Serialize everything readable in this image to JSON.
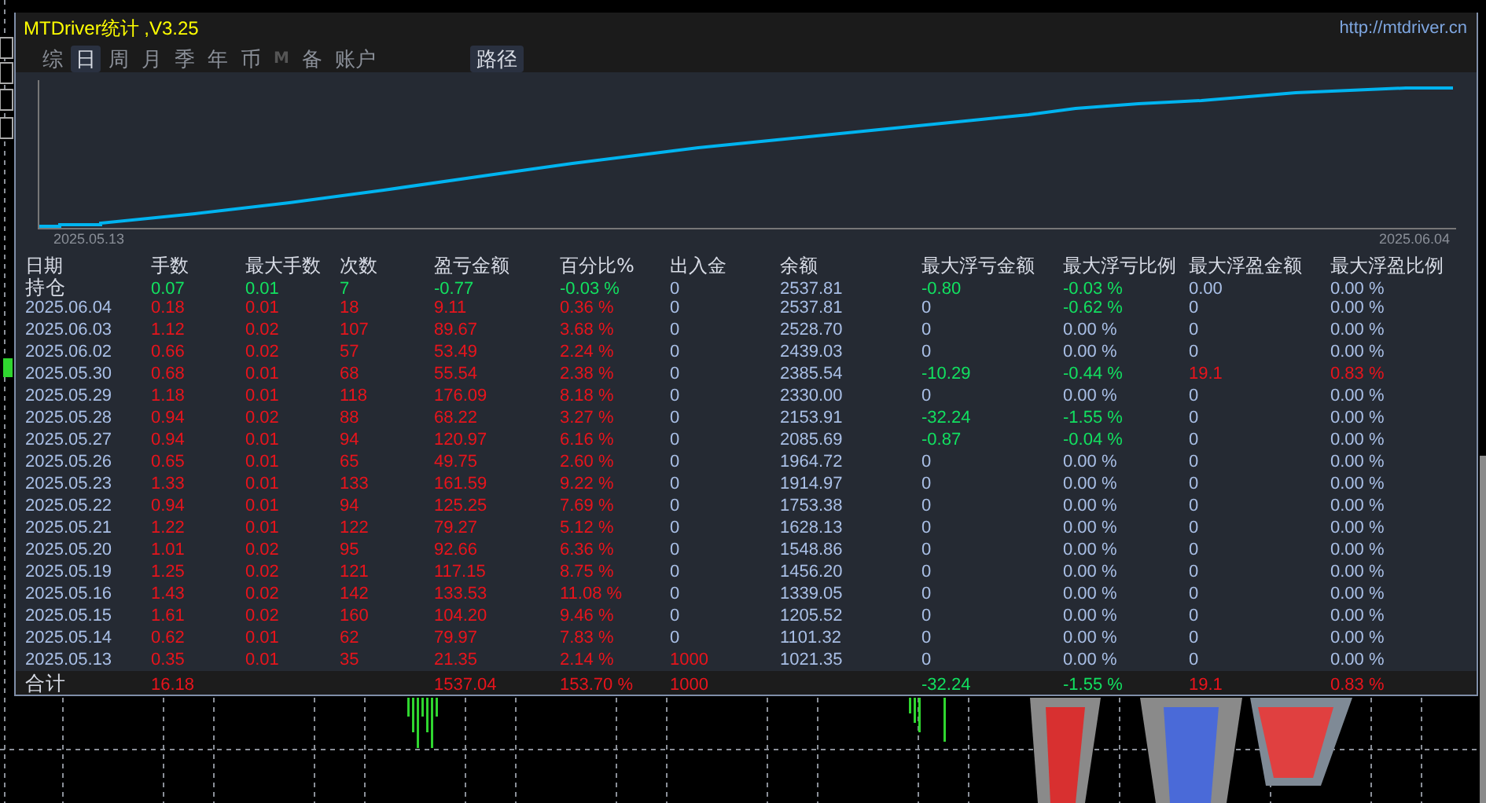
{
  "window": {
    "title": "MTDriver统计 ,V3.25",
    "link": "http://mtdriver.cn"
  },
  "tabs": [
    {
      "label": "综",
      "selected": false,
      "disabled": false
    },
    {
      "label": "日",
      "selected": true,
      "disabled": false
    },
    {
      "label": "周",
      "selected": false,
      "disabled": false
    },
    {
      "label": "月",
      "selected": false,
      "disabled": false
    },
    {
      "label": "季",
      "selected": false,
      "disabled": false
    },
    {
      "label": "年",
      "selected": false,
      "disabled": false
    },
    {
      "label": "币",
      "selected": false,
      "disabled": false
    },
    {
      "label": "M",
      "selected": false,
      "disabled": true
    },
    {
      "label": "备",
      "selected": false,
      "disabled": false
    },
    {
      "label": "账户",
      "selected": false,
      "disabled": false
    }
  ],
  "path_button": "路径",
  "balance_chart": {
    "start_date": "2025.05.13",
    "end_date": "2025.06.04"
  },
  "table": {
    "columns": [
      "日期",
      "手数",
      "最大手数",
      "次数",
      "盈亏金额",
      "百分比%",
      "出入金",
      "余额",
      "最大浮亏金额",
      "最大浮亏比例",
      "最大浮盈金额",
      "最大浮盈比例"
    ],
    "rows": [
      {
        "kind": "position",
        "cells": [
          {
            "text": "持仓",
            "color": "#d8dce6"
          },
          {
            "text": "0.07",
            "color": "#12e060"
          },
          {
            "text": "0.01",
            "color": "#12e060"
          },
          {
            "text": "7",
            "color": "#12e060"
          },
          {
            "text": "-0.77",
            "color": "#12e060"
          },
          {
            "text": "-0.03 %",
            "color": "#12e060"
          },
          {
            "text": "0",
            "color": "#a9bfe6"
          },
          {
            "text": "2537.81",
            "color": "#a9bfe6"
          },
          {
            "text": "-0.80",
            "color": "#12e060"
          },
          {
            "text": "-0.03 %",
            "color": "#12e060"
          },
          {
            "text": "0.00",
            "color": "#a9bfe6"
          },
          {
            "text": "0.00 %",
            "color": "#a9bfe6"
          }
        ]
      },
      {
        "kind": "day",
        "cells": [
          {
            "text": "2025.06.04",
            "color": "#a9bfe6"
          },
          {
            "text": "0.18",
            "color": "#e8141c"
          },
          {
            "text": "0.01",
            "color": "#e8141c"
          },
          {
            "text": "18",
            "color": "#e8141c"
          },
          {
            "text": "9.11",
            "color": "#e8141c"
          },
          {
            "text": "0.36 %",
            "color": "#e8141c"
          },
          {
            "text": "0",
            "color": "#a9bfe6"
          },
          {
            "text": "2537.81",
            "color": "#a9bfe6"
          },
          {
            "text": "0",
            "color": "#a9bfe6"
          },
          {
            "text": "-0.62 %",
            "color": "#12e060"
          },
          {
            "text": "0",
            "color": "#a9bfe6"
          },
          {
            "text": "0.00 %",
            "color": "#a9bfe6"
          }
        ]
      },
      {
        "kind": "day",
        "cells": [
          {
            "text": "2025.06.03",
            "color": "#a9bfe6"
          },
          {
            "text": "1.12",
            "color": "#e8141c"
          },
          {
            "text": "0.02",
            "color": "#e8141c"
          },
          {
            "text": "107",
            "color": "#e8141c"
          },
          {
            "text": "89.67",
            "color": "#e8141c"
          },
          {
            "text": "3.68 %",
            "color": "#e8141c"
          },
          {
            "text": "0",
            "color": "#a9bfe6"
          },
          {
            "text": "2528.70",
            "color": "#a9bfe6"
          },
          {
            "text": "0",
            "color": "#a9bfe6"
          },
          {
            "text": "0.00 %",
            "color": "#a9bfe6"
          },
          {
            "text": "0",
            "color": "#a9bfe6"
          },
          {
            "text": "0.00 %",
            "color": "#a9bfe6"
          }
        ]
      },
      {
        "kind": "day",
        "cells": [
          {
            "text": "2025.06.02",
            "color": "#a9bfe6"
          },
          {
            "text": "0.66",
            "color": "#e8141c"
          },
          {
            "text": "0.02",
            "color": "#e8141c"
          },
          {
            "text": "57",
            "color": "#e8141c"
          },
          {
            "text": "53.49",
            "color": "#e8141c"
          },
          {
            "text": "2.24 %",
            "color": "#e8141c"
          },
          {
            "text": "0",
            "color": "#a9bfe6"
          },
          {
            "text": "2439.03",
            "color": "#a9bfe6"
          },
          {
            "text": "0",
            "color": "#a9bfe6"
          },
          {
            "text": "0.00 %",
            "color": "#a9bfe6"
          },
          {
            "text": "0",
            "color": "#a9bfe6"
          },
          {
            "text": "0.00 %",
            "color": "#a9bfe6"
          }
        ]
      },
      {
        "kind": "day",
        "cells": [
          {
            "text": "2025.05.30",
            "color": "#a9bfe6"
          },
          {
            "text": "0.68",
            "color": "#e8141c"
          },
          {
            "text": "0.01",
            "color": "#e8141c"
          },
          {
            "text": "68",
            "color": "#e8141c"
          },
          {
            "text": "55.54",
            "color": "#e8141c"
          },
          {
            "text": "2.38 %",
            "color": "#e8141c"
          },
          {
            "text": "0",
            "color": "#a9bfe6"
          },
          {
            "text": "2385.54",
            "color": "#a9bfe6"
          },
          {
            "text": "-10.29",
            "color": "#12e060"
          },
          {
            "text": "-0.44 %",
            "color": "#12e060"
          },
          {
            "text": "19.1",
            "color": "#e8141c"
          },
          {
            "text": "0.83 %",
            "color": "#e8141c"
          }
        ]
      },
      {
        "kind": "day",
        "cells": [
          {
            "text": "2025.05.29",
            "color": "#a9bfe6"
          },
          {
            "text": "1.18",
            "color": "#e8141c"
          },
          {
            "text": "0.01",
            "color": "#e8141c"
          },
          {
            "text": "118",
            "color": "#e8141c"
          },
          {
            "text": "176.09",
            "color": "#e8141c"
          },
          {
            "text": "8.18 %",
            "color": "#e8141c"
          },
          {
            "text": "0",
            "color": "#a9bfe6"
          },
          {
            "text": "2330.00",
            "color": "#a9bfe6"
          },
          {
            "text": "0",
            "color": "#a9bfe6"
          },
          {
            "text": "0.00 %",
            "color": "#a9bfe6"
          },
          {
            "text": "0",
            "color": "#a9bfe6"
          },
          {
            "text": "0.00 %",
            "color": "#a9bfe6"
          }
        ]
      },
      {
        "kind": "day",
        "cells": [
          {
            "text": "2025.05.28",
            "color": "#a9bfe6"
          },
          {
            "text": "0.94",
            "color": "#e8141c"
          },
          {
            "text": "0.02",
            "color": "#e8141c"
          },
          {
            "text": "88",
            "color": "#e8141c"
          },
          {
            "text": "68.22",
            "color": "#e8141c"
          },
          {
            "text": "3.27 %",
            "color": "#e8141c"
          },
          {
            "text": "0",
            "color": "#a9bfe6"
          },
          {
            "text": "2153.91",
            "color": "#a9bfe6"
          },
          {
            "text": "-32.24",
            "color": "#12e060"
          },
          {
            "text": "-1.55 %",
            "color": "#12e060"
          },
          {
            "text": "0",
            "color": "#a9bfe6"
          },
          {
            "text": "0.00 %",
            "color": "#a9bfe6"
          }
        ]
      },
      {
        "kind": "day",
        "cells": [
          {
            "text": "2025.05.27",
            "color": "#a9bfe6"
          },
          {
            "text": "0.94",
            "color": "#e8141c"
          },
          {
            "text": "0.01",
            "color": "#e8141c"
          },
          {
            "text": "94",
            "color": "#e8141c"
          },
          {
            "text": "120.97",
            "color": "#e8141c"
          },
          {
            "text": "6.16 %",
            "color": "#e8141c"
          },
          {
            "text": "0",
            "color": "#a9bfe6"
          },
          {
            "text": "2085.69",
            "color": "#a9bfe6"
          },
          {
            "text": "-0.87",
            "color": "#12e060"
          },
          {
            "text": "-0.04 %",
            "color": "#12e060"
          },
          {
            "text": "0",
            "color": "#a9bfe6"
          },
          {
            "text": "0.00 %",
            "color": "#a9bfe6"
          }
        ]
      },
      {
        "kind": "day",
        "cells": [
          {
            "text": "2025.05.26",
            "color": "#a9bfe6"
          },
          {
            "text": "0.65",
            "color": "#e8141c"
          },
          {
            "text": "0.01",
            "color": "#e8141c"
          },
          {
            "text": "65",
            "color": "#e8141c"
          },
          {
            "text": "49.75",
            "color": "#e8141c"
          },
          {
            "text": "2.60 %",
            "color": "#e8141c"
          },
          {
            "text": "0",
            "color": "#a9bfe6"
          },
          {
            "text": "1964.72",
            "color": "#a9bfe6"
          },
          {
            "text": "0",
            "color": "#a9bfe6"
          },
          {
            "text": "0.00 %",
            "color": "#a9bfe6"
          },
          {
            "text": "0",
            "color": "#a9bfe6"
          },
          {
            "text": "0.00 %",
            "color": "#a9bfe6"
          }
        ]
      },
      {
        "kind": "day",
        "cells": [
          {
            "text": "2025.05.23",
            "color": "#a9bfe6"
          },
          {
            "text": "1.33",
            "color": "#e8141c"
          },
          {
            "text": "0.01",
            "color": "#e8141c"
          },
          {
            "text": "133",
            "color": "#e8141c"
          },
          {
            "text": "161.59",
            "color": "#e8141c"
          },
          {
            "text": "9.22 %",
            "color": "#e8141c"
          },
          {
            "text": "0",
            "color": "#a9bfe6"
          },
          {
            "text": "1914.97",
            "color": "#a9bfe6"
          },
          {
            "text": "0",
            "color": "#a9bfe6"
          },
          {
            "text": "0.00 %",
            "color": "#a9bfe6"
          },
          {
            "text": "0",
            "color": "#a9bfe6"
          },
          {
            "text": "0.00 %",
            "color": "#a9bfe6"
          }
        ]
      },
      {
        "kind": "day",
        "cells": [
          {
            "text": "2025.05.22",
            "color": "#a9bfe6"
          },
          {
            "text": "0.94",
            "color": "#e8141c"
          },
          {
            "text": "0.01",
            "color": "#e8141c"
          },
          {
            "text": "94",
            "color": "#e8141c"
          },
          {
            "text": "125.25",
            "color": "#e8141c"
          },
          {
            "text": "7.69 %",
            "color": "#e8141c"
          },
          {
            "text": "0",
            "color": "#a9bfe6"
          },
          {
            "text": "1753.38",
            "color": "#a9bfe6"
          },
          {
            "text": "0",
            "color": "#a9bfe6"
          },
          {
            "text": "0.00 %",
            "color": "#a9bfe6"
          },
          {
            "text": "0",
            "color": "#a9bfe6"
          },
          {
            "text": "0.00 %",
            "color": "#a9bfe6"
          }
        ]
      },
      {
        "kind": "day",
        "cells": [
          {
            "text": "2025.05.21",
            "color": "#a9bfe6"
          },
          {
            "text": "1.22",
            "color": "#e8141c"
          },
          {
            "text": "0.01",
            "color": "#e8141c"
          },
          {
            "text": "122",
            "color": "#e8141c"
          },
          {
            "text": "79.27",
            "color": "#e8141c"
          },
          {
            "text": "5.12 %",
            "color": "#e8141c"
          },
          {
            "text": "0",
            "color": "#a9bfe6"
          },
          {
            "text": "1628.13",
            "color": "#a9bfe6"
          },
          {
            "text": "0",
            "color": "#a9bfe6"
          },
          {
            "text": "0.00 %",
            "color": "#a9bfe6"
          },
          {
            "text": "0",
            "color": "#a9bfe6"
          },
          {
            "text": "0.00 %",
            "color": "#a9bfe6"
          }
        ]
      },
      {
        "kind": "day",
        "cells": [
          {
            "text": "2025.05.20",
            "color": "#a9bfe6"
          },
          {
            "text": "1.01",
            "color": "#e8141c"
          },
          {
            "text": "0.02",
            "color": "#e8141c"
          },
          {
            "text": "95",
            "color": "#e8141c"
          },
          {
            "text": "92.66",
            "color": "#e8141c"
          },
          {
            "text": "6.36 %",
            "color": "#e8141c"
          },
          {
            "text": "0",
            "color": "#a9bfe6"
          },
          {
            "text": "1548.86",
            "color": "#a9bfe6"
          },
          {
            "text": "0",
            "color": "#a9bfe6"
          },
          {
            "text": "0.00 %",
            "color": "#a9bfe6"
          },
          {
            "text": "0",
            "color": "#a9bfe6"
          },
          {
            "text": "0.00 %",
            "color": "#a9bfe6"
          }
        ]
      },
      {
        "kind": "day",
        "cells": [
          {
            "text": "2025.05.19",
            "color": "#a9bfe6"
          },
          {
            "text": "1.25",
            "color": "#e8141c"
          },
          {
            "text": "0.02",
            "color": "#e8141c"
          },
          {
            "text": "121",
            "color": "#e8141c"
          },
          {
            "text": "117.15",
            "color": "#e8141c"
          },
          {
            "text": "8.75 %",
            "color": "#e8141c"
          },
          {
            "text": "0",
            "color": "#a9bfe6"
          },
          {
            "text": "1456.20",
            "color": "#a9bfe6"
          },
          {
            "text": "0",
            "color": "#a9bfe6"
          },
          {
            "text": "0.00 %",
            "color": "#a9bfe6"
          },
          {
            "text": "0",
            "color": "#a9bfe6"
          },
          {
            "text": "0.00 %",
            "color": "#a9bfe6"
          }
        ]
      },
      {
        "kind": "day",
        "cells": [
          {
            "text": "2025.05.16",
            "color": "#a9bfe6"
          },
          {
            "text": "1.43",
            "color": "#e8141c"
          },
          {
            "text": "0.02",
            "color": "#e8141c"
          },
          {
            "text": "142",
            "color": "#e8141c"
          },
          {
            "text": "133.53",
            "color": "#e8141c"
          },
          {
            "text": "11.08 %",
            "color": "#e8141c"
          },
          {
            "text": "0",
            "color": "#a9bfe6"
          },
          {
            "text": "1339.05",
            "color": "#a9bfe6"
          },
          {
            "text": "0",
            "color": "#a9bfe6"
          },
          {
            "text": "0.00 %",
            "color": "#a9bfe6"
          },
          {
            "text": "0",
            "color": "#a9bfe6"
          },
          {
            "text": "0.00 %",
            "color": "#a9bfe6"
          }
        ]
      },
      {
        "kind": "day",
        "cells": [
          {
            "text": "2025.05.15",
            "color": "#a9bfe6"
          },
          {
            "text": "1.61",
            "color": "#e8141c"
          },
          {
            "text": "0.02",
            "color": "#e8141c"
          },
          {
            "text": "160",
            "color": "#e8141c"
          },
          {
            "text": "104.20",
            "color": "#e8141c"
          },
          {
            "text": "9.46 %",
            "color": "#e8141c"
          },
          {
            "text": "0",
            "color": "#a9bfe6"
          },
          {
            "text": "1205.52",
            "color": "#a9bfe6"
          },
          {
            "text": "0",
            "color": "#a9bfe6"
          },
          {
            "text": "0.00 %",
            "color": "#a9bfe6"
          },
          {
            "text": "0",
            "color": "#a9bfe6"
          },
          {
            "text": "0.00 %",
            "color": "#a9bfe6"
          }
        ]
      },
      {
        "kind": "day",
        "cells": [
          {
            "text": "2025.05.14",
            "color": "#a9bfe6"
          },
          {
            "text": "0.62",
            "color": "#e8141c"
          },
          {
            "text": "0.01",
            "color": "#e8141c"
          },
          {
            "text": "62",
            "color": "#e8141c"
          },
          {
            "text": "79.97",
            "color": "#e8141c"
          },
          {
            "text": "7.83 %",
            "color": "#e8141c"
          },
          {
            "text": "0",
            "color": "#a9bfe6"
          },
          {
            "text": "1101.32",
            "color": "#a9bfe6"
          },
          {
            "text": "0",
            "color": "#a9bfe6"
          },
          {
            "text": "0.00 %",
            "color": "#a9bfe6"
          },
          {
            "text": "0",
            "color": "#a9bfe6"
          },
          {
            "text": "0.00 %",
            "color": "#a9bfe6"
          }
        ]
      },
      {
        "kind": "day",
        "cells": [
          {
            "text": "2025.05.13",
            "color": "#a9bfe6"
          },
          {
            "text": "0.35",
            "color": "#e8141c"
          },
          {
            "text": "0.01",
            "color": "#e8141c"
          },
          {
            "text": "35",
            "color": "#e8141c"
          },
          {
            "text": "21.35",
            "color": "#e8141c"
          },
          {
            "text": "2.14 %",
            "color": "#e8141c"
          },
          {
            "text": "1000",
            "color": "#e8141c"
          },
          {
            "text": "1021.35",
            "color": "#a9bfe6"
          },
          {
            "text": "0",
            "color": "#a9bfe6"
          },
          {
            "text": "0.00 %",
            "color": "#a9bfe6"
          },
          {
            "text": "0",
            "color": "#a9bfe6"
          },
          {
            "text": "0.00 %",
            "color": "#a9bfe6"
          }
        ]
      },
      {
        "kind": "total",
        "cells": [
          {
            "text": "合计",
            "color": "#d8dce6"
          },
          {
            "text": "16.18",
            "color": "#e8141c"
          },
          null,
          null,
          {
            "text": "1537.04",
            "color": "#e8141c"
          },
          {
            "text": "153.70 %",
            "color": "#e8141c"
          },
          {
            "text": "1000",
            "color": "#e8141c"
          },
          null,
          {
            "text": "-32.24",
            "color": "#12e060"
          },
          {
            "text": "-1.55 %",
            "color": "#12e060"
          },
          {
            "text": "19.1",
            "color": "#e8141c"
          },
          {
            "text": "0.83 %",
            "color": "#e8141c"
          }
        ]
      }
    ]
  }
}
